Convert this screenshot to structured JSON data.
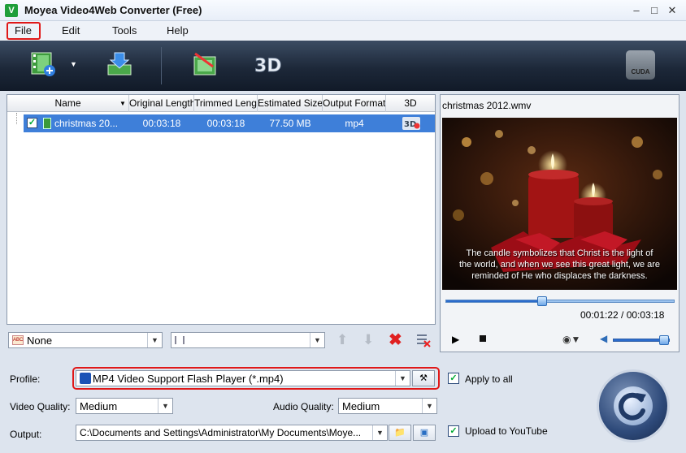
{
  "window": {
    "title": "Moyea Video4Web Converter (Free)",
    "app_icon": "V"
  },
  "menu": {
    "file": "File",
    "edit": "Edit",
    "tools": "Tools",
    "help": "Help"
  },
  "toolbar": {
    "cuda_label": "CUDA"
  },
  "file_list": {
    "columns": [
      "Name",
      "Original Length",
      "Trimmed Length",
      "Estimated Size",
      "Output Format",
      "3D"
    ],
    "rows": [
      {
        "name": "christmas 20...",
        "original_length": "00:03:18",
        "trimmed_length": "00:03:18",
        "estimated_size": "77.50 MB",
        "output_format": "mp4",
        "checked": "✓"
      }
    ]
  },
  "list_toolbar": {
    "subtitle_combo": "None"
  },
  "preview": {
    "title": "christmas 2012.wmv",
    "subtitle_line1": "The candle symbolizes that Christ is the light of",
    "subtitle_line2": "the world, and when we see this great light, we are",
    "subtitle_line3": "reminded of He who displaces the darkness.",
    "time": "00:01:22 / 00:03:18",
    "progress": 0.42
  },
  "settings": {
    "profile_label": "Profile:",
    "profile_value": "MP4 Video Support Flash Player (*.mp4)",
    "apply_to_all": "Apply to all",
    "video_quality_label": "Video Quality:",
    "video_quality_value": "Medium",
    "audio_quality_label": "Audio Quality:",
    "audio_quality_value": "Medium",
    "output_label": "Output:",
    "output_value": "C:\\Documents and Settings\\Administrator\\My Documents\\Moye...",
    "upload_youtube": "Upload to YouTube"
  }
}
